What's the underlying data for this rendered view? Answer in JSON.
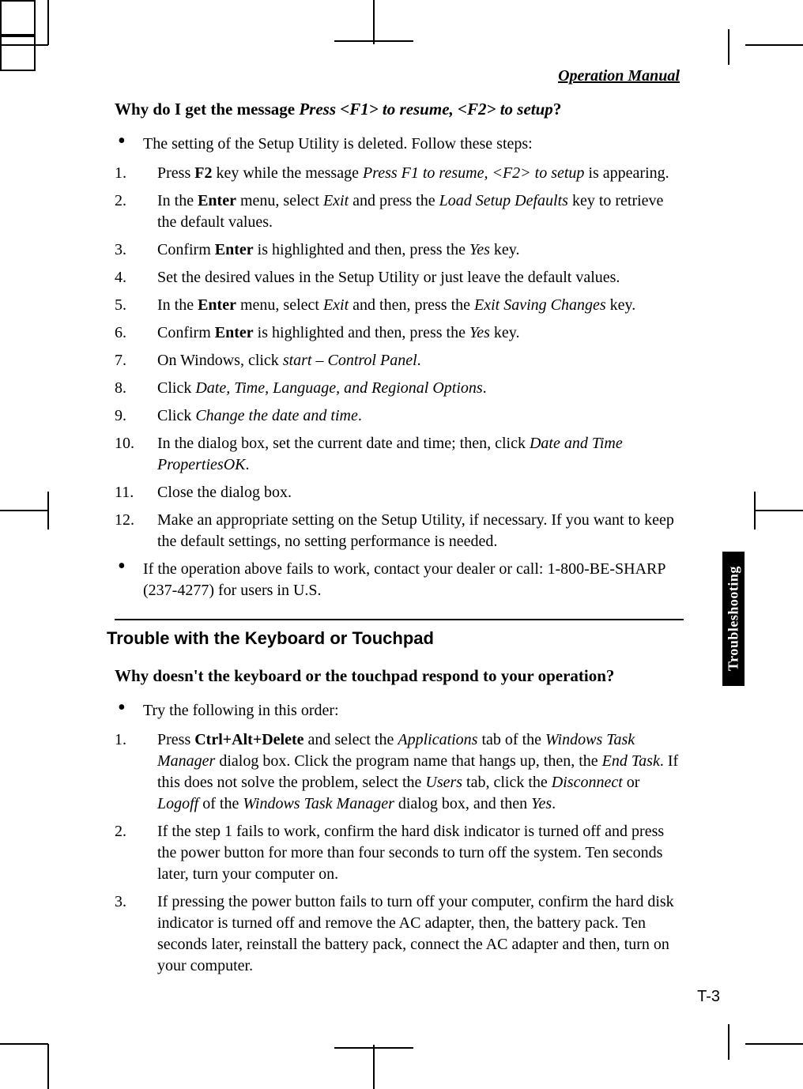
{
  "header": {
    "running_title": "Operation Manual"
  },
  "side_tab": "Troubleshooting",
  "page_number": "T-3",
  "section1": {
    "question_prefix": "Why do I get the message ",
    "question_ital": "Press <F1> to resume, <F2> to setup",
    "question_suffix": "?",
    "bullet_intro": "The setting of the Setup Utility is deleted. Follow these steps:",
    "steps": [
      {
        "n": "1.",
        "pre": "Press ",
        "b1": "F2",
        "mid1": " key while the message ",
        "i1": "Press F1 to resume, <F2> to setup",
        "post": " is appearing."
      },
      {
        "n": "2.",
        "pre": "In the ",
        "i1": "Exit",
        "mid1": " menu, select ",
        "i2": "Load Setup Defaults",
        "mid2": " and press the ",
        "b1": "Enter",
        "post": " key to retrieve the default values."
      },
      {
        "n": "3.",
        "pre": "Confirm ",
        "i1": "Yes",
        "mid1": " is highlighted and then, press the ",
        "b1": "Enter",
        "post": " key."
      },
      {
        "n": "4.",
        "pre": "Set the desired values in the Setup Utility or just leave the default values.",
        "i1": "",
        "mid1": "",
        "b1": "",
        "post": ""
      },
      {
        "n": "5.",
        "pre": "In the ",
        "i1": "Exit",
        "mid1": " menu, select ",
        "i2": "Exit Saving Changes",
        "mid2": " and then, press the ",
        "b1": "Enter",
        "post": " key."
      },
      {
        "n": "6.",
        "pre": "Confirm ",
        "i1": "Yes",
        "mid1": " is highlighted and then, press the ",
        "b1": "Enter",
        "post": " key."
      },
      {
        "n": "7.",
        "pre": "On Windows, click ",
        "i1": "start – Control Panel",
        "post": "."
      },
      {
        "n": "8.",
        "pre": "Click ",
        "i1": "Date, Time, Language, and Regional Options",
        "post": "."
      },
      {
        "n": "9.",
        "pre": "Click ",
        "i1": "Change the date and time",
        "post": "."
      },
      {
        "n": "10.",
        "pre": "In the ",
        "i1": "Date and Time Properties",
        "mid1": " dialog box, set the current date and time; then, click ",
        "i2": "OK",
        "post": "."
      },
      {
        "n": "11.",
        "pre": "Close the dialog box.",
        "post": ""
      },
      {
        "n": "12.",
        "pre": "Make an appropriate setting on the Setup Utility, if necessary. If you want to keep the default settings, no setting performance is needed.",
        "post": ""
      }
    ],
    "bullet_outro": "If the operation above fails to work, contact your dealer or call: 1-800-BE-SHARP (237-4277) for users in U.S."
  },
  "section2": {
    "title": "Trouble with the Keyboard or Touchpad",
    "question": "Why doesn't the keyboard or the touchpad respond to your operation?",
    "bullet_intro": "Try the following in this order:",
    "steps": [
      {
        "n": "1.",
        "pre": "Press ",
        "b1": "Ctrl+Alt+Delete",
        "mid1": " and select the ",
        "i1": "Applications",
        "mid2": " tab of the ",
        "i2": "Windows Task Manager",
        "mid3": " dialog box. Click the program name that hangs up, then, the ",
        "i3": "End Task",
        "mid4": ". If this does not solve the problem, select the ",
        "i4": "Users",
        "mid5": " tab, click the ",
        "i5": "Disconnect",
        "mid6": " or ",
        "i6": "Logoff",
        "mid7": " of the ",
        "i7": "Windows Task Manager",
        "mid8": " dialog box, and then ",
        "i8": "Yes",
        "post": "."
      },
      {
        "n": "2.",
        "pre": "If the step 1 fails to work, confirm the hard disk indicator is turned off and press the power button for more than four seconds to turn off the system. Ten seconds later, turn your computer on.",
        "post": ""
      },
      {
        "n": "3.",
        "pre": "If pressing the power button fails to turn off your computer, confirm the hard disk indicator is turned off and remove the AC adapter, then, the battery pack. Ten seconds later, reinstall the battery pack, connect the AC adapter and then, turn on your computer.",
        "post": ""
      }
    ]
  }
}
